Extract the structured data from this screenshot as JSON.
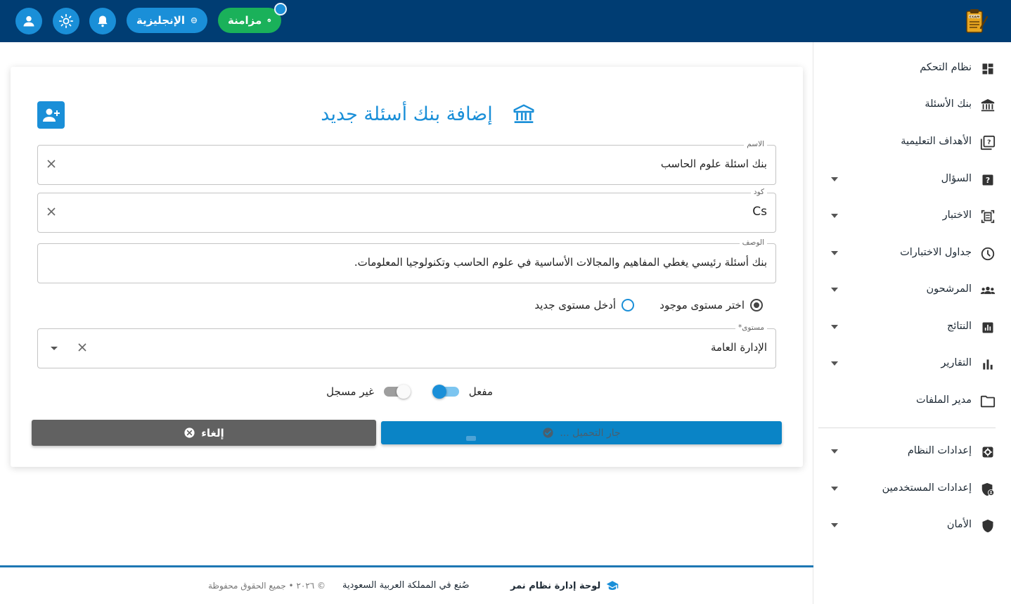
{
  "topbar": {
    "language_label": "الإنجليزية",
    "sync_label": "مزامنة",
    "profile_icon": "user-icon",
    "theme_icon": "sun-icon",
    "notifications_icon": "bell-icon",
    "logo_text": "EXAM"
  },
  "sidebar": {
    "items": [
      {
        "label": "نظام التحكم",
        "icon": "dashboard-icon",
        "expandable": false
      },
      {
        "label": "بنك الأسئلة",
        "icon": "bank-icon",
        "expandable": false
      },
      {
        "label": "الأهداف التعليمية",
        "icon": "quiz-icon",
        "expandable": false
      },
      {
        "label": "السؤال",
        "icon": "question-icon",
        "expandable": true
      },
      {
        "label": "الاختبار",
        "icon": "exam-icon",
        "expandable": true
      },
      {
        "label": "جداول الاختبارات",
        "icon": "clock-icon",
        "expandable": true
      },
      {
        "label": "المرشحون",
        "icon": "people-icon",
        "expandable": true
      },
      {
        "label": "النتائج",
        "icon": "results-icon",
        "expandable": true
      },
      {
        "label": "التقارير",
        "icon": "bar-chart-icon",
        "expandable": true
      },
      {
        "label": "مدير الملفات",
        "icon": "folder-icon",
        "expandable": false
      },
      {
        "label": "إعدادات النظام",
        "icon": "settings-icon",
        "expandable": true
      },
      {
        "label": "إعدادات المستخدمين",
        "icon": "shield-user-icon",
        "expandable": true
      },
      {
        "label": "الأمان",
        "icon": "shield-icon",
        "expandable": true
      }
    ]
  },
  "form": {
    "title": "إضافة بنك أسئلة جديد",
    "name_label": "الاسم",
    "name_value": "بنك اسئلة علوم الحاسب",
    "code_label": "كود",
    "code_value": "Cs",
    "description_label": "الوصف",
    "description_value": "بنك أسئلة رئيسي يغطي المفاهيم والمجالات الأساسية في علوم الحاسب وتكنولوجيا المعلومات.",
    "level_mode_existing": "اختر مستوى موجود",
    "level_mode_new": "أدخل مستوى جديد",
    "level_mode_selected": "existing",
    "level_label": "مستوى*",
    "level_value": "الإدارة العامة",
    "status_active_label": "مفعل",
    "status_inactive_label": "غير مسجل",
    "active_toggle": true,
    "inactive_toggle": false,
    "cancel_label": "إلغاء",
    "save_label": "جار التحميل ..."
  },
  "footer": {
    "brand": "لوحة إدارة نظام نمر",
    "made_in": "صُنع في المملكة العربية السعودية",
    "rights": "© ٢٠٢٦ • جميع الحقوق محفوظة"
  },
  "colors": {
    "topbar": "#003d73",
    "primary": "#1a8fd8",
    "sync": "#1ab15a",
    "cancel": "#616161"
  }
}
